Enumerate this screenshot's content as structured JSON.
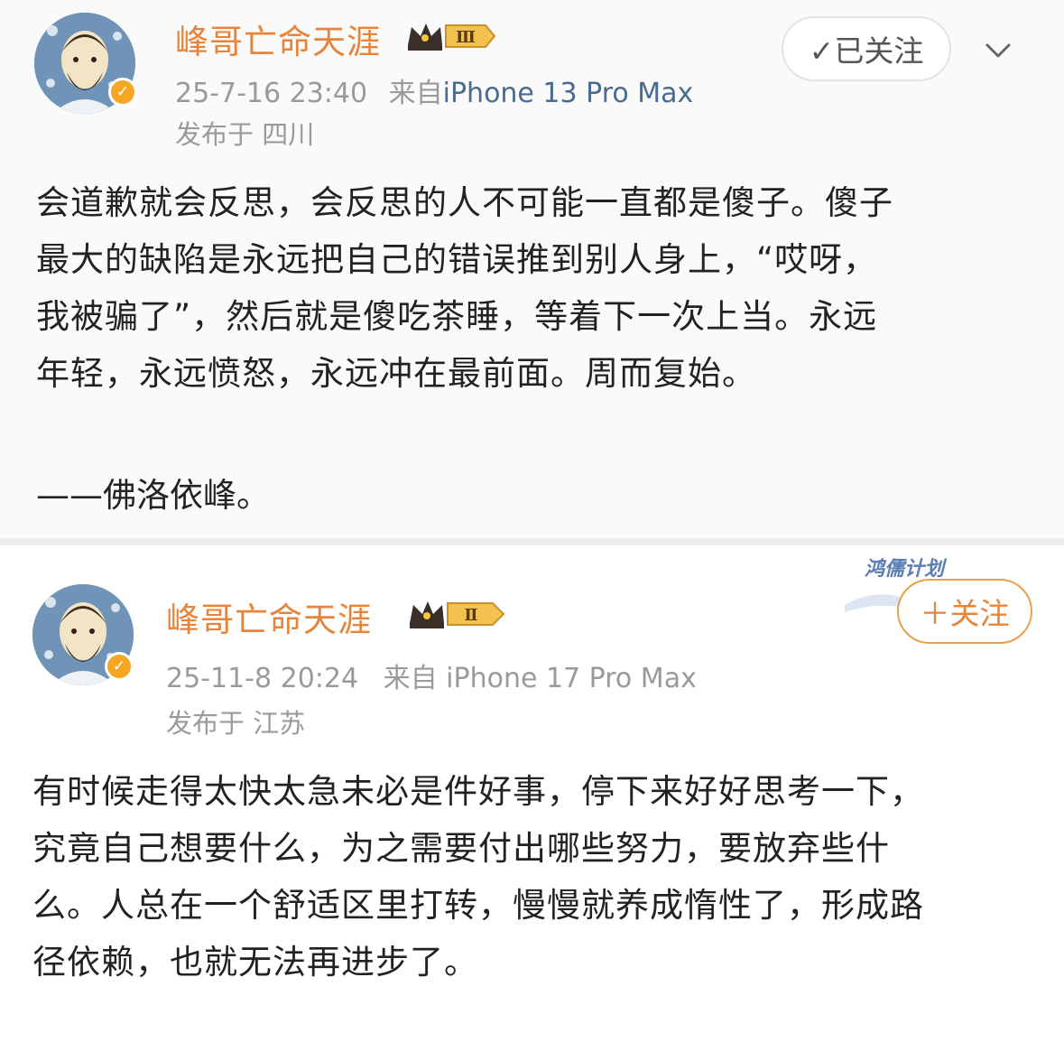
{
  "posts": [
    {
      "username": "峰哥亡命天涯",
      "level_badge": "Ⅲ",
      "timestamp": "25-7-16 23:40",
      "source_prefix": "来自",
      "device": "iPhone 13 Pro Max",
      "location": "发布于 四川",
      "follow_label": "✓已关注",
      "body_lines": [
        "会道歉就会反思，会反思的人不可能一直都是傻子。傻子",
        "最大的缺陷是永远把自己的错误推到别人身上，“哎呀，",
        "我被骗了”，然后就是傻吃茶睡，等着下一次上当。永远",
        "年轻，永远愤怒，永远冲在最前面。周而复始。"
      ],
      "attribution": "——佛洛依峰。"
    },
    {
      "username": "峰哥亡命天涯",
      "level_badge": "Ⅱ",
      "timestamp": "25-11-8 20:24",
      "source_prefix": "来自",
      "device": "iPhone 17 Pro Max",
      "location": "发布于 江苏",
      "follow_label": "＋关注",
      "campaign_tag": "鸿儒计划",
      "body_lines": [
        "有时候走得太快太急未必是件好事，停下来好好思考一下，",
        "究竟自己想要什么，为之需要付出哪些努力，要放弃些什",
        "么。人总在一个舒适区里打转，慢慢就养成惰性了，形成路",
        "径依赖，也就无法再进步了。"
      ]
    }
  ],
  "colors": {
    "username": "#e8843a",
    "meta": "#9a9a9a",
    "device": "#4a6a8f",
    "body": "#222222",
    "verified_badge": "#f5a623"
  },
  "icons": {
    "verified": "verified-badge-icon",
    "crown": "crown-level-icon",
    "chevron": "chevron-down-icon"
  }
}
